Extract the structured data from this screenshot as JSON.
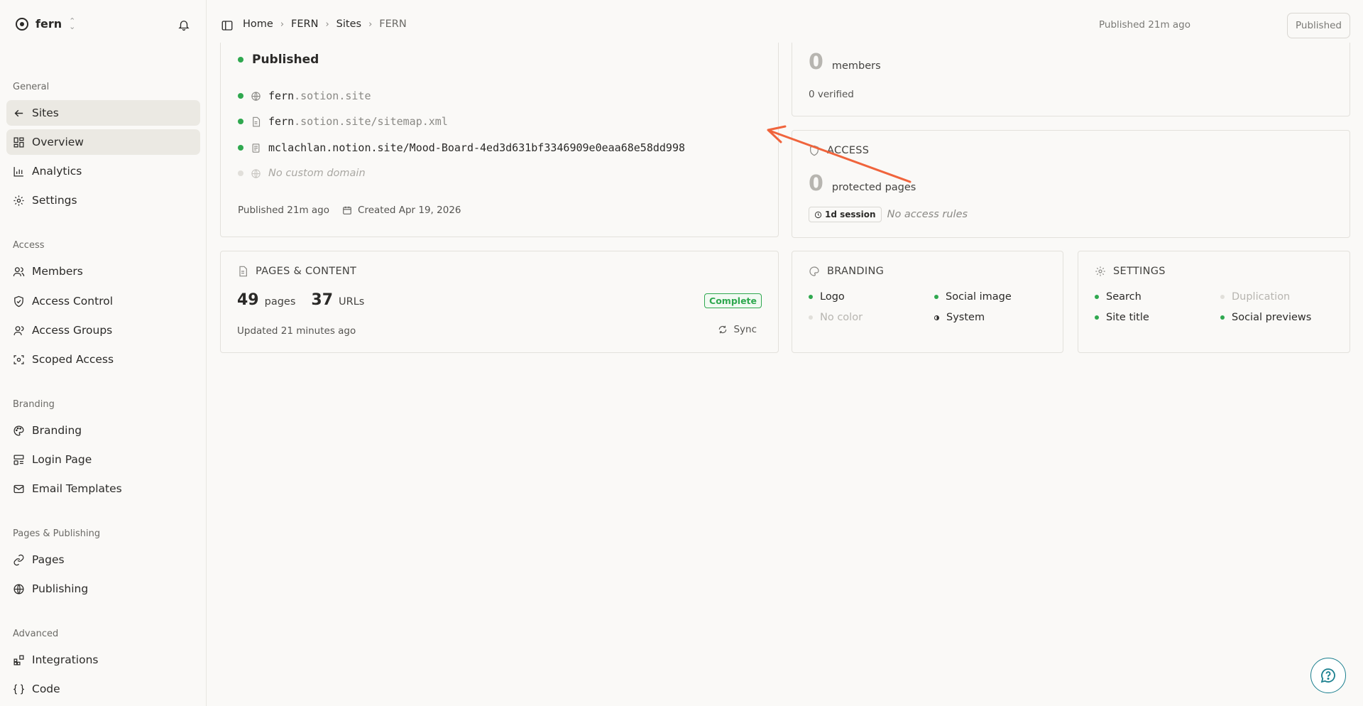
{
  "workspace": {
    "name": "fern"
  },
  "sidebar": {
    "sections": [
      {
        "label": "General"
      },
      {
        "label": "Access"
      },
      {
        "label": "Branding"
      },
      {
        "label": "Pages & Publishing"
      },
      {
        "label": "Advanced"
      }
    ],
    "items": [
      {
        "label": "Sites"
      },
      {
        "label": "Overview"
      },
      {
        "label": "Analytics"
      },
      {
        "label": "Settings"
      },
      {
        "label": "Members"
      },
      {
        "label": "Access Control"
      },
      {
        "label": "Access Groups"
      },
      {
        "label": "Scoped Access"
      },
      {
        "label": "Branding"
      },
      {
        "label": "Login Page"
      },
      {
        "label": "Email Templates"
      },
      {
        "label": "Pages"
      },
      {
        "label": "Publishing"
      },
      {
        "label": "Integrations"
      },
      {
        "label": "Code"
      }
    ]
  },
  "breadcrumb": [
    "Home",
    "FERN",
    "Sites",
    "FERN"
  ],
  "header": {
    "published_time": "Published 21m ago",
    "published_button": "Published"
  },
  "status_card": {
    "status": "Published",
    "domains": [
      {
        "host": "fern",
        "rest": ".sotion.site"
      },
      {
        "host": "fern",
        "rest": ".sotion.site/sitemap.xml"
      },
      {
        "host": "mclachlan.notion.site/Mood-Board-4ed3d631bf3346909e0eaa68e58dd998",
        "rest": ""
      }
    ],
    "no_custom_domain": "No custom domain",
    "published": "Published 21m ago",
    "created": "Created Apr 19, 2026"
  },
  "members_card": {
    "count": "0",
    "unit": "members",
    "verified": "0 verified"
  },
  "access_card": {
    "title": "ACCESS",
    "count": "0",
    "unit": "protected pages",
    "session": "1d session",
    "rules": "No access rules"
  },
  "pages_card": {
    "title": "PAGES & CONTENT",
    "pages": "49",
    "pages_unit": "pages",
    "urls": "37",
    "urls_unit": "URLs",
    "badge": "Complete",
    "updated": "Updated 21 minutes ago",
    "sync": "Sync"
  },
  "branding_card": {
    "title": "BRANDING",
    "logo": "Logo",
    "social_image": "Social image",
    "no_color": "No color",
    "system": "System"
  },
  "settings_card": {
    "title": "SETTINGS",
    "search": "Search",
    "duplication": "Duplication",
    "site_title": "Site title",
    "social_previews": "Social previews"
  },
  "colors": {
    "accent_green": "#2fa84f",
    "arrow": "#f0643c",
    "help_teal": "#1a7f8e"
  }
}
